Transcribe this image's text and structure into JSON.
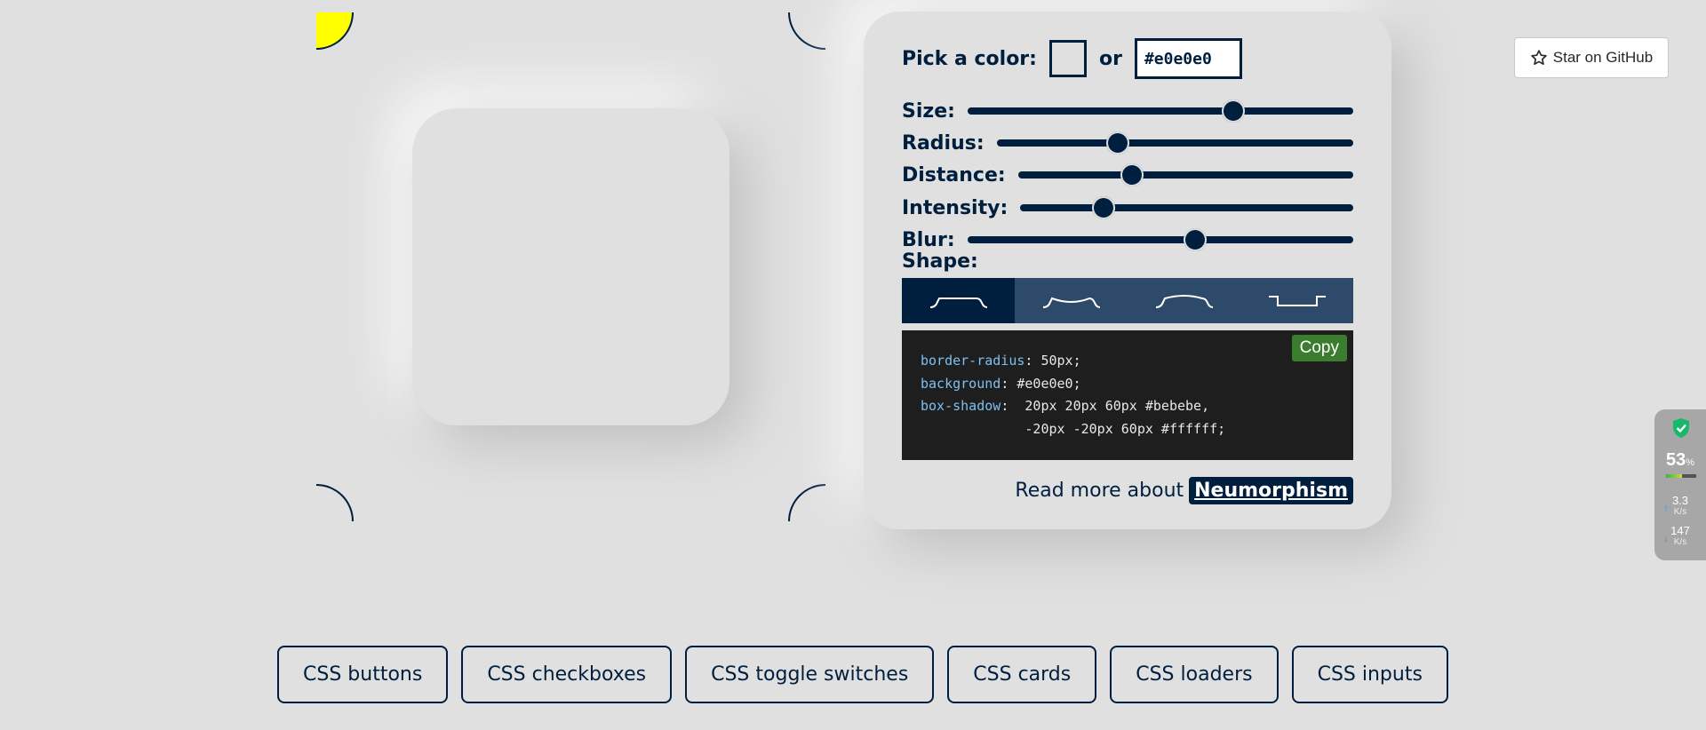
{
  "config": {
    "pick_color_label": "Pick a color:",
    "or_label": "or",
    "hex_value": "#e0e0e0",
    "sliders": [
      {
        "label": "Size:",
        "value_fraction": 0.69
      },
      {
        "label": "Radius:",
        "value_fraction": 0.34
      },
      {
        "label": "Distance:",
        "value_fraction": 0.34
      },
      {
        "label": "Intensity:",
        "value_fraction": 0.25
      },
      {
        "label": "Blur:",
        "value_fraction": 0.59
      }
    ],
    "shape_label": "Shape:",
    "shapes": [
      "flat",
      "concave",
      "convex",
      "pressed"
    ],
    "active_shape": "flat",
    "code": {
      "l1_prop": "border-radius",
      "l1_val": ": 50px;",
      "l2_prop": "background",
      "l2_val": ": #e0e0e0;",
      "l3_prop": "box-shadow",
      "l3_val": ":  20px 20px 60px #bebebe,",
      "l4_val": "             -20px -20px 60px #ffffff;"
    },
    "copy_label": "Copy",
    "read_more_text": "Read more about",
    "read_more_link": "Neumorphism"
  },
  "preview": {
    "selected_corner": "top-left",
    "corner_highlight_color": "#ffff00",
    "background_color": "#e0e0e0",
    "accent_color": "#001f3f"
  },
  "github": {
    "label": "Star on GitHub",
    "icon": "star-icon"
  },
  "net_widget": {
    "percent": "53",
    "percent_unit": "%",
    "load_fraction": 0.53,
    "upload_value": "3.3",
    "upload_unit": "K/s",
    "download_value": "147",
    "download_unit": "K/s",
    "icon": "shield-check-icon"
  },
  "bottom_nav": [
    "CSS buttons",
    "CSS checkboxes",
    "CSS toggle switches",
    "CSS cards",
    "CSS loaders",
    "CSS inputs"
  ]
}
